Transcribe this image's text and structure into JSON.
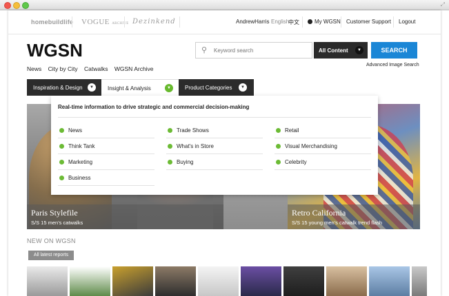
{
  "toplinks": {
    "brand1": "homebuildlife",
    "brand2_main": "VOGUE",
    "brand2_sub": "ARCHIVE",
    "brand3": "Dezinkend",
    "username": "AndrewHarris",
    "lang_en": "English",
    "lang_zh": "中文",
    "my_wgsn": "My WGSN",
    "support": "Customer Support",
    "logout": "Logout"
  },
  "logo": "WGSN",
  "search": {
    "placeholder": "Keyword search",
    "scope": "All Content",
    "button": "SEARCH",
    "advanced": "Advanced Image Search"
  },
  "nav": [
    "News",
    "City by City",
    "Catwalks",
    "WGSN Archive"
  ],
  "menu": {
    "tab1": "Inspiration & Design",
    "tab2": "Insight & Analysis",
    "tab3": "Product Categories"
  },
  "dropdown": {
    "heading": "Real-time information to drive strategic and commercial decision-making",
    "col1": [
      "News",
      "Think Tank",
      "Marketing",
      "Business"
    ],
    "col2": [
      "Trade Shows",
      "What's in Store",
      "Buying"
    ],
    "col3": [
      "Retail",
      "Visual Merchandising",
      "Celebrity"
    ]
  },
  "hero": {
    "left_title": "Paris Stylefile",
    "left_sub": "S/S 15 men's catwalks",
    "right_title": "Retro California",
    "right_sub": "S/S 15 young men's catwalk trend flash"
  },
  "newon": {
    "heading": "NEW ON WGSN",
    "button": "All latest reports"
  },
  "colors": {
    "accent_green": "#67b92d",
    "search_blue": "#1a86d6",
    "menu_dark": "#2c2c2c"
  }
}
